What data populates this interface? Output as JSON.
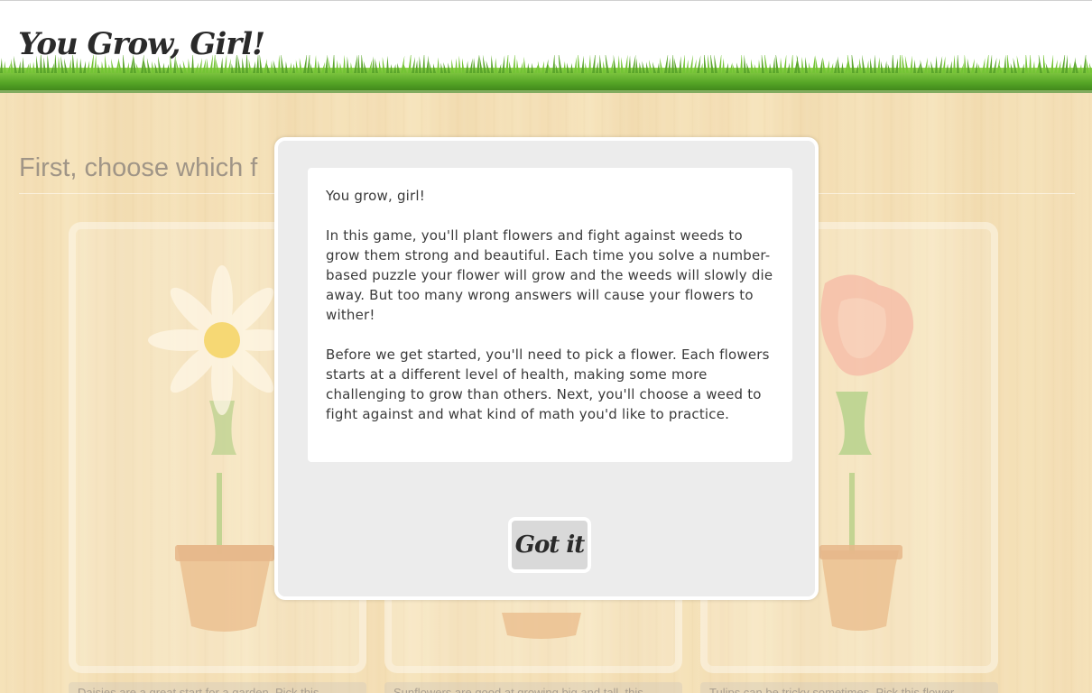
{
  "header": {
    "logo_text": "You Grow, Girl!"
  },
  "main": {
    "heading": "First, choose which f"
  },
  "cards": [
    {
      "flower": "daisy-icon",
      "description": "Daisies are a great start for a garden. Pick this"
    },
    {
      "flower": "sunflower-icon",
      "description": "Sunflowers are good at growing big and tall, this"
    },
    {
      "flower": "tulip-icon",
      "description": "Tulips can be tricky sometimes. Pick this flower"
    }
  ],
  "modal": {
    "greeting": "You grow, girl!",
    "paragraph_1": "In this game, you'll plant flowers and fight against weeds to grow them strong and beautiful. Each time you solve a number-based puzzle your flower will grow and the weeds will slowly die away. But too many wrong answers will cause your flowers to wither!",
    "paragraph_2": "Before we get started, you'll need to pick a flower. Each flowers starts at a different level of health, making some more challenging to grow than others. Next, you'll choose a weed to fight against and what kind of math you'd like to practice.",
    "button_label": "Got it"
  },
  "colors": {
    "grass": "#5aa62b",
    "wood": "#f0d7a3",
    "modal_bg": "#ececec",
    "button_bg": "#d9d9d9"
  }
}
